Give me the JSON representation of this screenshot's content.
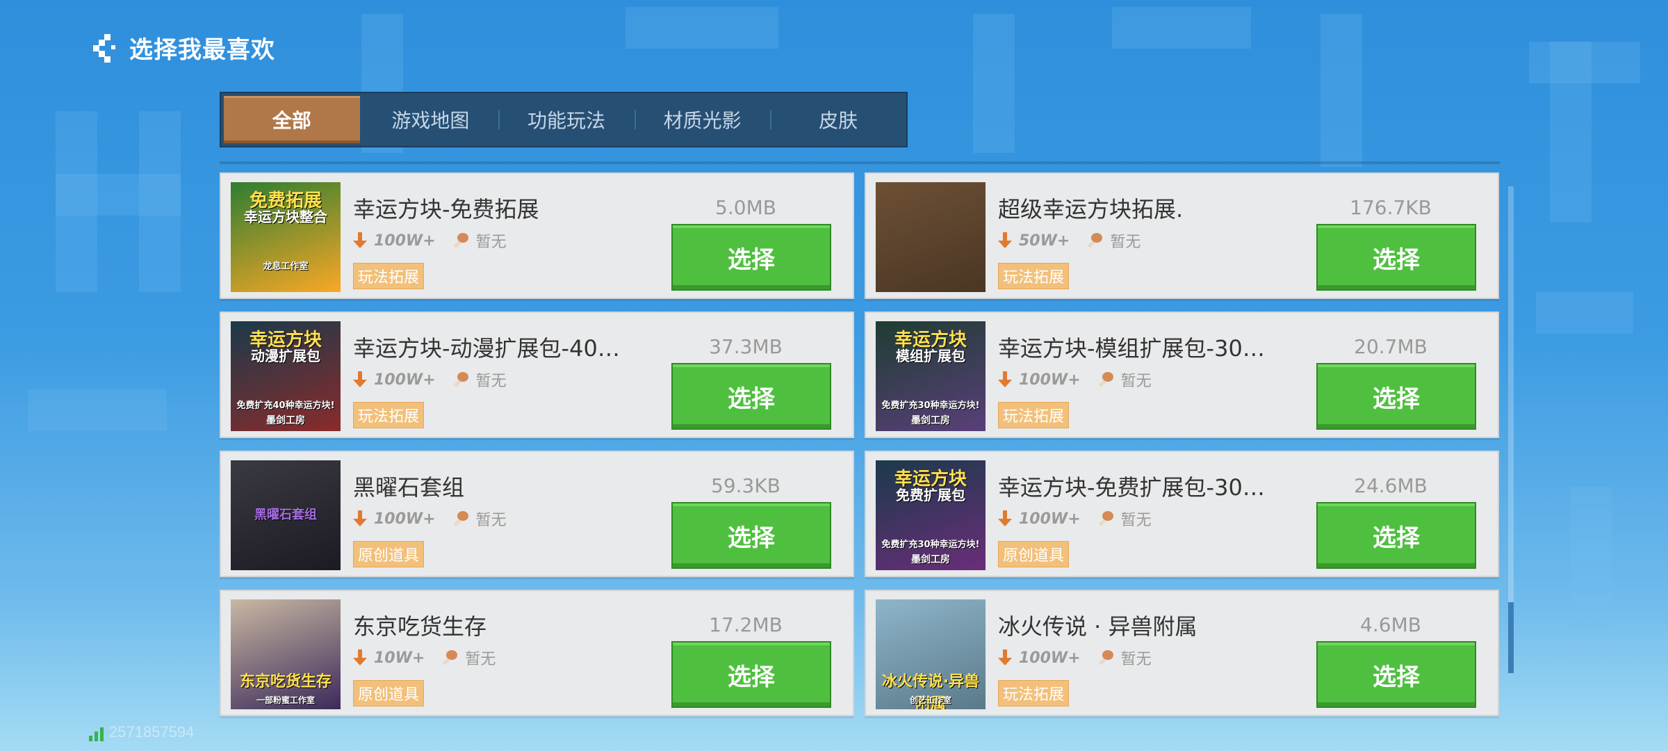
{
  "header": {
    "title": "选择我最喜欢"
  },
  "tabs": [
    {
      "label": "全部",
      "active": true
    },
    {
      "label": "游戏地图",
      "active": false
    },
    {
      "label": "功能玩法",
      "active": false
    },
    {
      "label": "材质光影",
      "active": false
    },
    {
      "label": "皮肤",
      "active": false
    }
  ],
  "items": [
    {
      "name": "幸运方块-免费拓展",
      "downloads": "100W+",
      "rating": "暂无",
      "tag": "玩法拓展",
      "size": "5.0MB",
      "button": "选择",
      "thumb": {
        "lines": [
          "免费拓展",
          "幸运方块整合",
          "龙息工作室"
        ],
        "colors": [
          "#2e7d32",
          "#f9a825"
        ]
      }
    },
    {
      "name": "超级幸运方块拓展.",
      "downloads": "50W+",
      "rating": "暂无",
      "tag": "玩法拓展",
      "size": "176.7KB",
      "button": "选择",
      "thumb": {
        "lines": [],
        "colors": [
          "#6d5035",
          "#4a3624"
        ]
      }
    },
    {
      "name": "幸运方块-动漫扩展包-40…",
      "downloads": "100W+",
      "rating": "暂无",
      "tag": "玩法拓展",
      "size": "37.3MB",
      "button": "选择",
      "thumb": {
        "lines": [
          "幸运方块",
          "动漫扩展包",
          "免费扩充40种幸运方块!",
          "墨剑工房"
        ],
        "colors": [
          "#1b3a4b",
          "#8a2b2b"
        ]
      }
    },
    {
      "name": "幸运方块-模组扩展包-30…",
      "downloads": "100W+",
      "rating": "暂无",
      "tag": "玩法拓展",
      "size": "20.7MB",
      "button": "选择",
      "thumb": {
        "lines": [
          "幸运方块",
          "模组扩展包",
          "免费扩充30种幸运方块!",
          "墨剑工房"
        ],
        "colors": [
          "#1f3d33",
          "#5a3f7a"
        ]
      }
    },
    {
      "name": "黑曜石套组",
      "downloads": "100W+",
      "rating": "暂无",
      "tag": "原创道具",
      "size": "59.3KB",
      "button": "选择",
      "thumb": {
        "lines": [
          "黑曜石套组"
        ],
        "colors": [
          "#3a3a42",
          "#1c1a24"
        ]
      }
    },
    {
      "name": "幸运方块-免费扩展包-30…",
      "downloads": "100W+",
      "rating": "暂无",
      "tag": "原创道具",
      "size": "24.6MB",
      "button": "选择",
      "thumb": {
        "lines": [
          "幸运方块",
          "免费扩展包",
          "免费扩充30种幸运方块!",
          "墨剑工房"
        ],
        "colors": [
          "#1b3a4b",
          "#6b2d7a"
        ]
      }
    },
    {
      "name": "东京吃货生存",
      "downloads": "10W+",
      "rating": "暂无",
      "tag": "原创道具",
      "size": "17.2MB",
      "button": "选择",
      "thumb": {
        "lines": [
          "东京吃货生存",
          "一部粉蜜工作室"
        ],
        "colors": [
          "#c9b8a2",
          "#3b2a5a"
        ]
      }
    },
    {
      "name": "冰火传说 · 异兽附属",
      "downloads": "100W+",
      "rating": "暂无",
      "tag": "玩法拓展",
      "size": "4.6MB",
      "button": "选择",
      "thumb": {
        "lines": [
          "冰火传说·异兽附属",
          "创艺工作室"
        ],
        "colors": [
          "#8fb5c9",
          "#5a7a8a"
        ]
      }
    }
  ],
  "footer": {
    "uid": "2571857594"
  },
  "colors": {
    "accent_green": "#4fbf3f",
    "tab_active": "#b07848",
    "tag_bg": "#f2c07a",
    "download_arrow": "#e07a30"
  }
}
